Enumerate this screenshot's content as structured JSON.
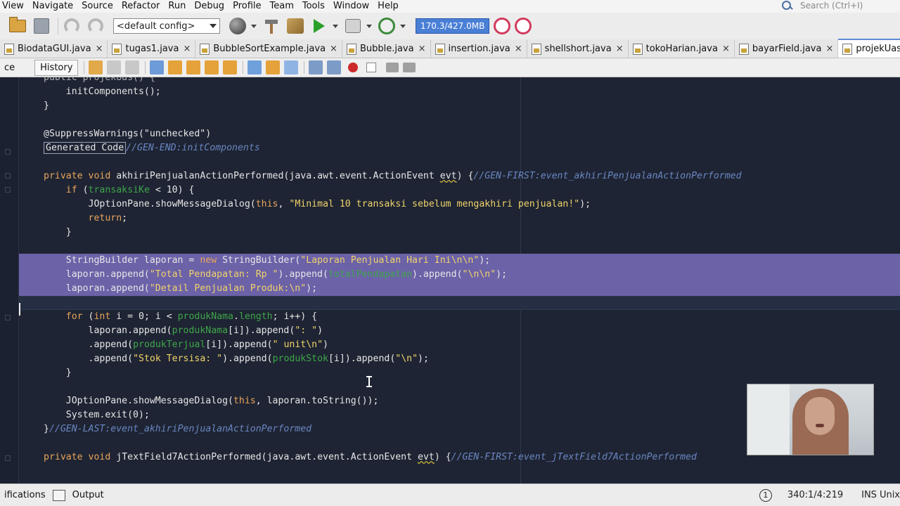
{
  "menu": [
    "View",
    "Navigate",
    "Source",
    "Refactor",
    "Run",
    "Debug",
    "Profile",
    "Team",
    "Tools",
    "Window",
    "Help"
  ],
  "search_placeholder": "Search (Ctrl+I)",
  "toolbar": {
    "config_value": "<default config>",
    "memory": "170.3/427.0MB"
  },
  "tabs": [
    {
      "label": "BiodataGUI.java"
    },
    {
      "label": "tugas1.java"
    },
    {
      "label": "BubbleSortExample.java"
    },
    {
      "label": "Bubble.java"
    },
    {
      "label": "insertion.java"
    },
    {
      "label": "shellshort.java"
    },
    {
      "label": "tokoHarian.java"
    },
    {
      "label": "bayarField.java"
    },
    {
      "label": "projekUas.java"
    }
  ],
  "close_glyph": "×",
  "editor_tabs": {
    "source": "ce",
    "history": "History"
  },
  "code": {
    "l0": "public projekUas() {",
    "l1": "initComponents();",
    "l2": "}",
    "l3": "@SuppressWarnings(\"unchecked\")",
    "l4_box": "Generated Code",
    "l4_cm": "//GEN-END:initComponents",
    "l5_kw1": "private",
    "l5_kw2": "void",
    "l5_rest": "akhiriPenjualanActionPerformed(java.awt.event.ActionEvent",
    "l5_evt": "evt",
    "l5_brace": ") {",
    "l5_cm": "//GEN-FIRST:event_akhiriPenjualanActionPerformed",
    "l6_kw": "if",
    "l6_fld": "transaksiKe",
    "l6_rest": " < 10) {",
    "l7_pre": "JOptionPane.showMessageDialog(",
    "l7_kw": "this",
    "l7_str": "\"Minimal 10 transaksi sebelum mengakhiri penjualan!\"",
    "l7_post": ");",
    "l8_kw": "return",
    "l8_post": ";",
    "l9": "}",
    "l10_pre": "StringBuilder laporan = ",
    "l10_kw": "new",
    "l10_mid": " StringBuilder(",
    "l10_str": "\"Laporan Penjualan Hari Ini\\n\\n\"",
    "l10_post": ");",
    "l11_pre": "laporan.append(",
    "l11_str": "\"Total Pendapatan: Rp \"",
    "l11_mid": ").append(",
    "l11_fld": "totalPendapatan",
    "l11_mid2": ").append(",
    "l11_str2": "\"\\n\\n\"",
    "l11_post": ");",
    "l12_pre": "laporan.append(",
    "l12_str": "\"Detail Penjualan Produk:\\n\"",
    "l12_post": ");",
    "l14_kw": "for",
    "l14_kw2": "int",
    "l14_mid": " i = 0; i < ",
    "l14_fld": "produkNama",
    "l14_dot": ".",
    "l14_fld2": "length",
    "l14_post": "; i++) {",
    "l15_pre": "laporan.append(",
    "l15_fld": "produkNama",
    "l15_mid": "[i]).append(",
    "l15_str": "\": \"",
    "l15_post": ")",
    "l16_pre": ".append(",
    "l16_fld": "produkTerjual",
    "l16_mid": "[i]).append(",
    "l16_str": "\" unit\\n\"",
    "l16_post": ")",
    "l17_pre": ".append(",
    "l17_str": "\"Stok Tersisa: \"",
    "l17_mid": ").append(",
    "l17_fld": "produkStok",
    "l17_mid2": "[i]).append(",
    "l17_str2": "\"\\n\"",
    "l17_post": ");",
    "l18": "}",
    "l20_pre": "JOptionPane.showMessageDialog(",
    "l20_kw": "this",
    "l20_post": ", laporan.toString());",
    "l21": "System.exit(0);",
    "l22_brace": "}",
    "l22_cm": "//GEN-LAST:event_akhiriPenjualanActionPerformed",
    "l24_kw1": "private",
    "l24_kw2": "void",
    "l24_rest": "jTextField7ActionPerformed(java.awt.event.ActionEvent",
    "l24_evt": "evt",
    "l24_brace": ") {",
    "l24_cm": "//GEN-FIRST:event_jTextField7ActionPerformed"
  },
  "status": {
    "notifications": "ifications",
    "output": "Output",
    "notif_count": "1",
    "position": "340:1/4:219",
    "mode": "INS",
    "line_ending": "Unix"
  }
}
